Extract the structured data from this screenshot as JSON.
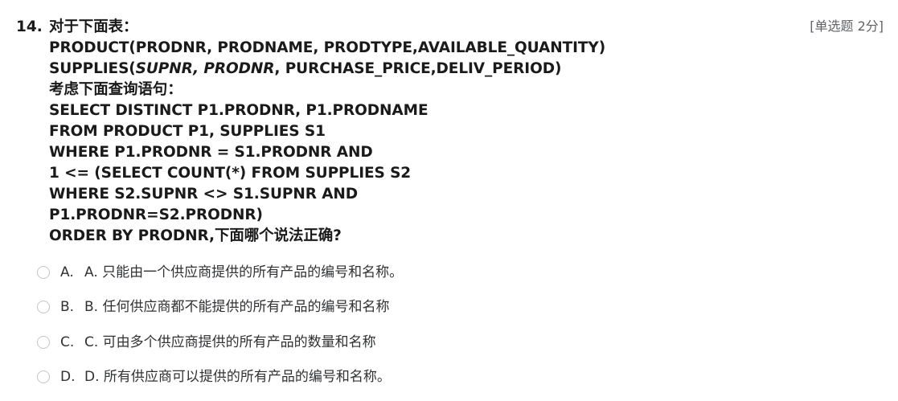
{
  "question": {
    "number": "14.",
    "meta": "[单选题 2分]",
    "stem": {
      "intro": "对于下面表：",
      "table1": "PRODUCT(PRODNR, PRODNAME, PRODTYPE,AVAILABLE_QUANTITY)",
      "table2_prefix": "SUPPLIES(",
      "table2_italic": "SUPNR, PRODNR",
      "table2_suffix": ", PURCHASE_PRICE,DELIV_PERIOD)",
      "query_intro": "考虑下面查询语句：",
      "sql_lines": [
        "SELECT DISTINCT P1.PRODNR, P1.PRODNAME",
        "FROM PRODUCT P1, SUPPLIES S1",
        "WHERE P1.PRODNR = S1.PRODNR AND",
        "1 <= (SELECT COUNT(*) FROM SUPPLIES S2",
        "WHERE S2.SUPNR <> S1.SUPNR AND",
        "P1.PRODNR=S2.PRODNR)",
        "ORDER BY PRODNR,下面哪个说法正确?"
      ]
    },
    "options": [
      {
        "letter": "A.",
        "text": "A. 只能由一个供应商提供的所有产品的编号和名称。"
      },
      {
        "letter": "B.",
        "text": "B. 任何供应商都不能提供的所有产品的编号和名称"
      },
      {
        "letter": "C.",
        "text": "C. 可由多个供应商提供的所有产品的数量和名称"
      },
      {
        "letter": "D.",
        "text": "D. 所有供应商可以提供的所有产品的编号和名称。"
      }
    ]
  }
}
